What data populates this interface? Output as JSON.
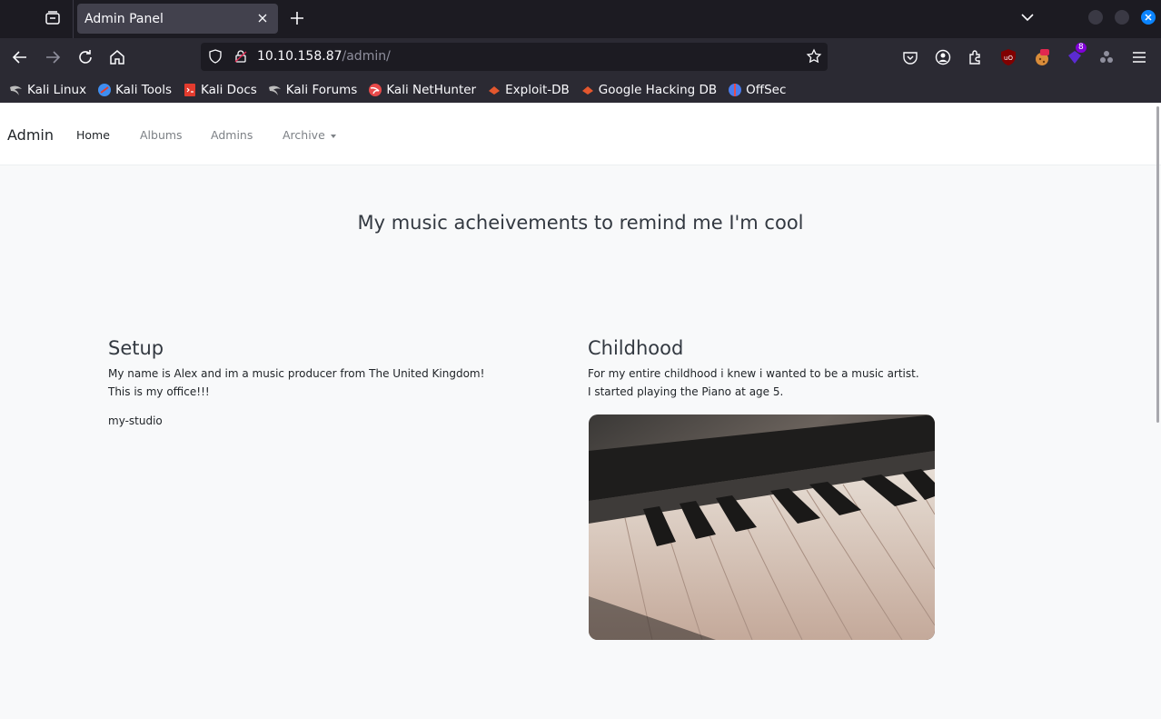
{
  "browser": {
    "tab_title": "Admin Panel",
    "url_host": "10.10.158.87",
    "url_path": "/admin/",
    "extension_badge": "8",
    "bookmarks": [
      {
        "label": "Kali Linux",
        "icon": "kali-dragon-icon",
        "color": "#bdbdbd"
      },
      {
        "label": "Kali Tools",
        "icon": "kali-tools-icon",
        "color": "#3f8ef0"
      },
      {
        "label": "Kali Docs",
        "icon": "kali-docs-icon",
        "color": "#e33b2e"
      },
      {
        "label": "Kali Forums",
        "icon": "kali-dragon-icon",
        "color": "#bdbdbd"
      },
      {
        "label": "Kali NetHunter",
        "icon": "nethunter-icon",
        "color": "#e84a4a"
      },
      {
        "label": "Exploit-DB",
        "icon": "exploit-db-icon",
        "color": "#e4572e"
      },
      {
        "label": "Google Hacking DB",
        "icon": "ghdb-icon",
        "color": "#e4572e"
      },
      {
        "label": "OffSec",
        "icon": "offsec-icon",
        "color": "#4b7bec"
      }
    ]
  },
  "site": {
    "brand": "Admin",
    "nav": [
      {
        "label": "Home",
        "active": true
      },
      {
        "label": "Albums",
        "active": false
      },
      {
        "label": "Admins",
        "active": false
      },
      {
        "label": "Archive",
        "active": false,
        "dropdown": true
      }
    ],
    "hero_title": "My music acheivements to remind me I'm cool",
    "sections": [
      {
        "heading": "Setup",
        "lines": [
          "My name is Alex and im a music producer from The United Kingdom!",
          "This is my office!!!"
        ],
        "image_alt": "my-studio"
      },
      {
        "heading": "Childhood",
        "lines": [
          "For my entire childhood i knew i wanted to be a music artist.",
          "I started playing the Piano at age 5."
        ],
        "image": "piano-keys-photo"
      }
    ]
  }
}
